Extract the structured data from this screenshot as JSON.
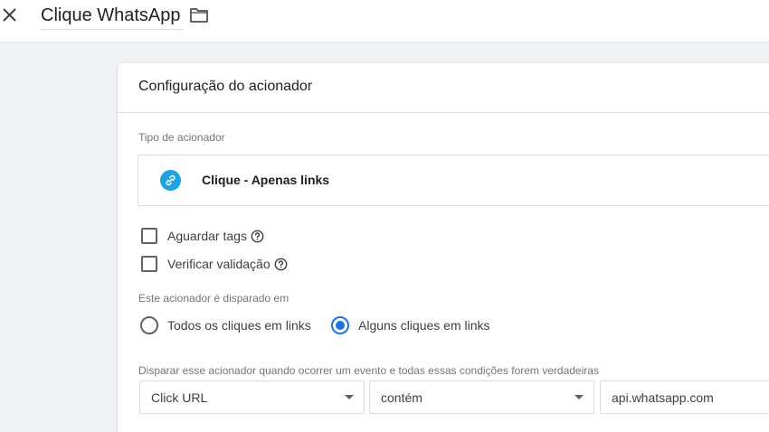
{
  "header": {
    "title": "Clique WhatsApp",
    "close_icon": "close-icon",
    "folder_icon": "folder-icon"
  },
  "card": {
    "title": "Configuração do acionador",
    "trigger_type": {
      "label": "Tipo de acionador",
      "value": "Clique - Apenas links",
      "icon": "link-icon",
      "icon_color": "#1aa3e8"
    },
    "options": [
      {
        "label": "Aguardar tags",
        "checked": false
      },
      {
        "label": "Verificar validação",
        "checked": false
      }
    ],
    "fires_on": {
      "label": "Este acionador é disparado em",
      "choices": [
        {
          "label": "Todos os cliques em links",
          "selected": false
        },
        {
          "label": "Alguns cliques em links",
          "selected": true
        }
      ]
    },
    "condition": {
      "label": "Disparar esse acionador quando ocorrer um evento e todas essas condições forem verdadeiras",
      "variable": "Click URL",
      "operator": "contém",
      "value": "api.whatsapp.com"
    }
  },
  "colors": {
    "accent": "#1a73e8",
    "background": "#f1f2f4"
  }
}
